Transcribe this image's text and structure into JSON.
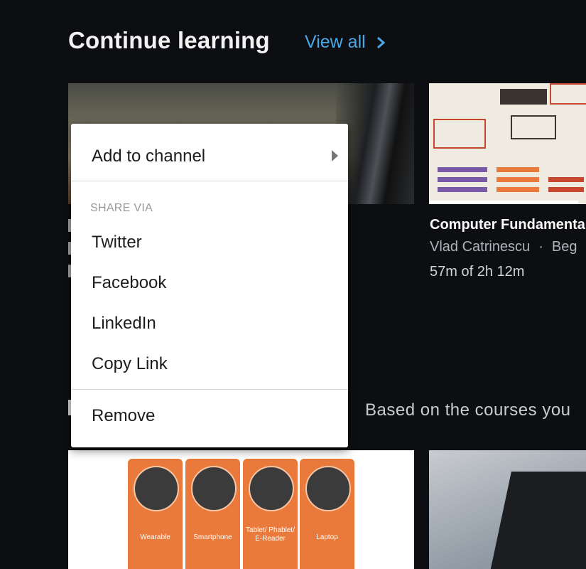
{
  "section": {
    "title": "Continue learning",
    "view_all": "View all"
  },
  "course_card": {
    "title": "Computer Fundamenta",
    "author": "Vlad Catrinescu",
    "separator": "·",
    "level": "Beg",
    "progress": "57m of 2h 12m"
  },
  "recommendations": {
    "subtitle": "Based on the courses you"
  },
  "device_tiles": [
    "Wearable",
    "Smartphone",
    "Tablet/ Phablet/ E-Reader",
    "Laptop"
  ],
  "context_menu": {
    "add_to_channel": "Add to channel",
    "share_via": "SHARE VIA",
    "twitter": "Twitter",
    "facebook": "Facebook",
    "linkedin": "LinkedIn",
    "copy_link": "Copy Link",
    "remove": "Remove"
  },
  "colors": {
    "background": "#0d0e11",
    "accent": "#48a9e6",
    "tile_orange": "#ea7a3b"
  }
}
